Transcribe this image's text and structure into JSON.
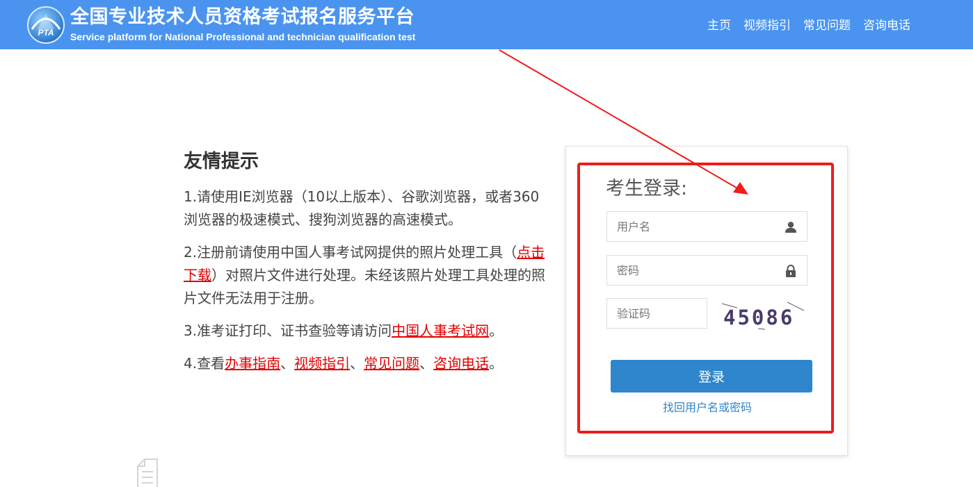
{
  "header": {
    "logo_text": "PTA",
    "title": "全国专业技术人员资格考试报名服务平台",
    "subtitle": "Service platform for National Professional and technician qualification test",
    "nav": [
      {
        "label": "主页"
      },
      {
        "label": "视频指引"
      },
      {
        "label": "常见问题"
      },
      {
        "label": "咨询电话"
      }
    ]
  },
  "tips": {
    "heading": "友情提示",
    "item1": "1.请使用IE浏览器（10以上版本）、谷歌浏览器，或者360浏览器的极速模式、搜狗浏览器的高速模式。",
    "item2": {
      "before": "2.注册前请使用中国人事考试网提供的照片处理工具（",
      "link": "点击下载",
      "after": "）对照片文件进行处理。未经该照片处理工具处理的照片文件无法用于注册。"
    },
    "item3": {
      "before": "3.准考证打印、证书查验等请访问",
      "link": "中国人事考试网",
      "after": "。"
    },
    "item4": {
      "before": "4.查看",
      "links": [
        "办事指南",
        "视频指引",
        "常见问题",
        "咨询电话"
      ],
      "separator": "、",
      "after": "。"
    }
  },
  "login": {
    "title": "考生登录:",
    "username_placeholder": "用户名",
    "password_placeholder": "密码",
    "captcha_placeholder": "验证码",
    "captcha_text": "45086",
    "submit_label": "登录",
    "forgot_label": "找回用户名或密码"
  },
  "icons": {
    "user": "user-icon",
    "lock": "lock-icon",
    "logo": "pta-logo"
  },
  "colors": {
    "header_bg": "#4a94f0",
    "button_bg": "#2f86cc",
    "link_red": "#e30000",
    "annotation_red": "#f21a1a"
  }
}
